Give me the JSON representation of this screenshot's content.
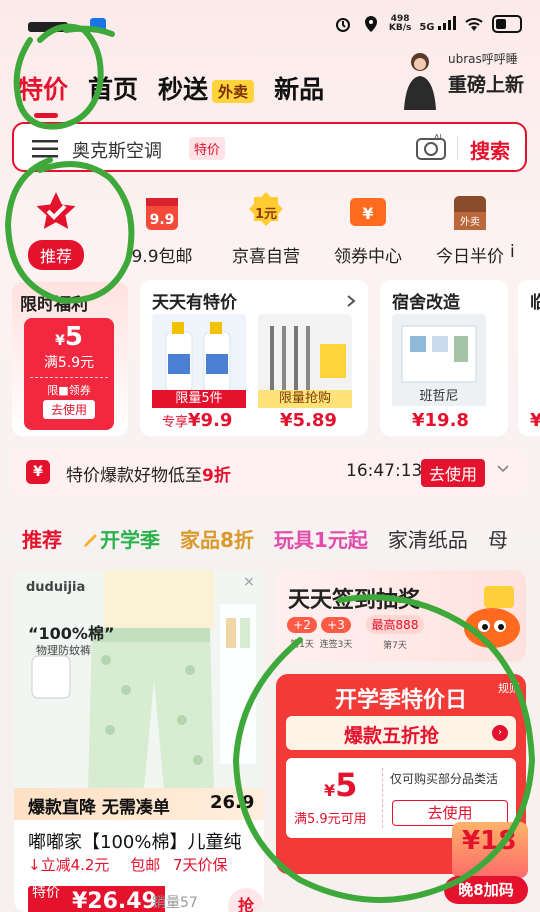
{
  "status_bar": {
    "speed_value": "498",
    "speed_unit": "KB/s",
    "network": "5G"
  },
  "tabs": [
    {
      "label": "特价"
    },
    {
      "label": "首页"
    },
    {
      "label": "秒送",
      "badge": "外卖"
    },
    {
      "label": "新品"
    }
  ],
  "promo": {
    "sub": "ubras呼呼睡",
    "main": "重磅上新"
  },
  "search": {
    "query": "奥克斯空调",
    "tag": "特价",
    "button": "搜索"
  },
  "categories": [
    {
      "label": "推荐",
      "icon": "star-check-icon"
    },
    {
      "label": "9.9包邮",
      "icon": "gift-box-icon"
    },
    {
      "label": "京喜自营",
      "icon": "medal-icon"
    },
    {
      "label": "领券中心",
      "icon": "coupon-icon"
    },
    {
      "label": "今日半价",
      "icon": "bag-icon"
    },
    {
      "label": "i"
    }
  ],
  "deals": {
    "coupon": {
      "title": "限时福利",
      "amount": "5",
      "currency": "¥",
      "condition": "满5.9元",
      "note": "限■领券",
      "button": "去使用"
    },
    "daily": {
      "title": "天天有特价",
      "items": [
        {
          "tag": "限量5件",
          "price_prefix": "专享",
          "price": "¥9.9"
        },
        {
          "tag": "限量抢购",
          "price": "¥5.89"
        }
      ]
    },
    "dorm": {
      "title": "宿舍改造",
      "tag": "班哲尼",
      "price": "¥19.8"
    },
    "next": {
      "title": "临",
      "price": "¥"
    }
  },
  "ticker": {
    "icon": "¥",
    "text": "特价爆款好物低至",
    "highlight": "9折",
    "time": "16:47:13",
    "button": "去使用"
  },
  "filters": [
    "推荐",
    "开学季",
    "家品8折",
    "玩具1元起",
    "家清纸品",
    "母"
  ],
  "product": {
    "brand": "duduijia",
    "headline": "“100%棉”",
    "subline": "物理防蚊裤",
    "banner": "爆款直降 无需凑单",
    "banner_price": "26.9",
    "name": "嘟嘟家【100%棉】儿童纯",
    "discount": "立减4.2元",
    "shipping": "包邮",
    "guarantee": "7天价保",
    "price_tag": "特价",
    "price": "¥26.49",
    "sold": "销量57",
    "cart": "抢"
  },
  "signin": {
    "title": "天天签到抽奖",
    "days": [
      {
        "chip": "+2",
        "label": "第1天"
      },
      {
        "chip": "+3",
        "label": "连签3天"
      },
      {
        "chip": "最高888",
        "label": "第7天"
      }
    ]
  },
  "back_to_school": {
    "title": "开学季特价日",
    "rule": "规则",
    "bar": "爆款五折抢",
    "coupon_amount": "5",
    "coupon_currency": "¥",
    "coupon_cond": "满5.9元可用",
    "coupon_note": "仅可购买部分品类活",
    "coupon_button": "去使用"
  },
  "floating": {
    "value": "¥18",
    "label": "晚8加码"
  },
  "colors": {
    "brand_red": "#e5122d",
    "annotation_green": "#3fa83a"
  }
}
